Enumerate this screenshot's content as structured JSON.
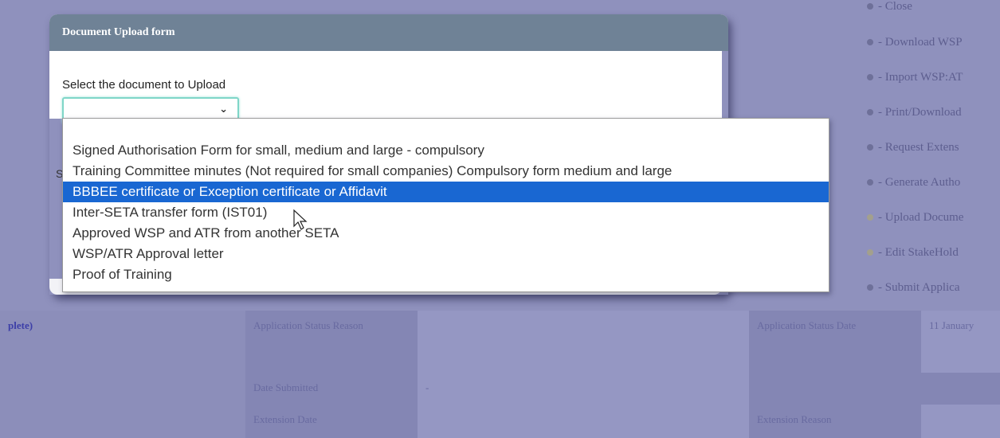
{
  "modal": {
    "title": "Document Upload form",
    "select_label": "Select the document to Upload",
    "select_value": "",
    "partial_label": "S"
  },
  "dropdown": {
    "selected_index": 2,
    "options": [
      "Signed Authorisation Form for small, medium and large - compulsory",
      "Training Committee minutes (Not required for small companies) Compulsory form medium and large",
      "BBBEE certificate or Exception certificate or Affidavit",
      "Inter-SETA transfer form (IST01)",
      "Approved WSP and ATR from another SETA",
      "WSP/ATR Approval letter",
      "Proof of Training"
    ]
  },
  "right_menu": {
    "items": [
      "- Close",
      "- Download WSP",
      "- Import WSP:AT",
      "- Print/Download",
      "- Request Extens",
      "- Generate Autho",
      "- Upload Docume",
      "- Edit StakeHold",
      "- Submit Applica"
    ]
  },
  "status_table": {
    "row1": {
      "left": "plete)",
      "label1": "Application Status Reason",
      "value1": "",
      "label2": "Application Status Date",
      "value2": "11 January"
    },
    "row2": {
      "label1": "Date Submitted",
      "value1": "-"
    },
    "row3": {
      "label1": "Extension Date",
      "value1": "",
      "label2": "Extension Reason"
    }
  }
}
